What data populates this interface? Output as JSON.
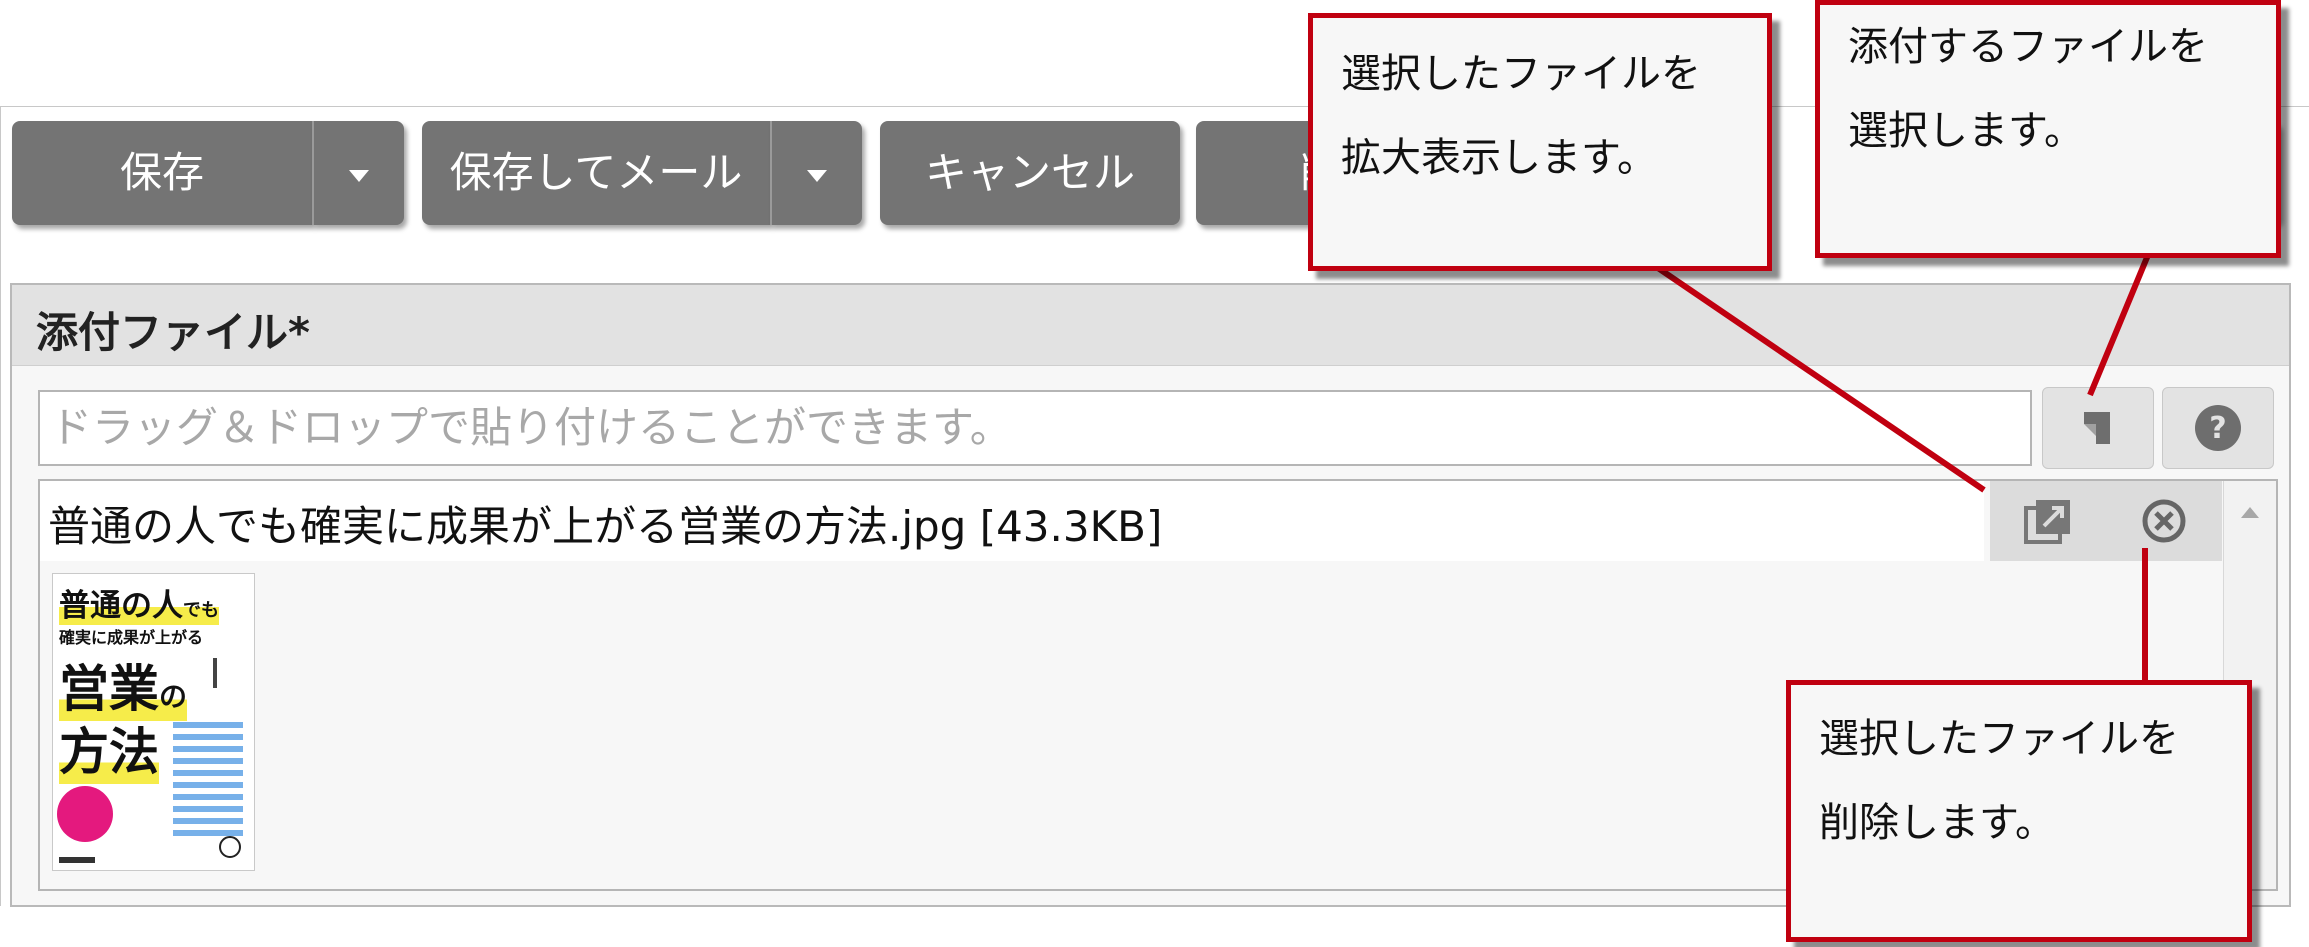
{
  "toolbar": {
    "save_label": "保存",
    "save_mail_label": "保存してメール",
    "cancel_label": "キャンセル",
    "hidden_button_char": "削"
  },
  "section": {
    "title": "添付ファイル*",
    "drop_placeholder": "ドラッグ＆ドロップで貼り付けることができます。"
  },
  "file": {
    "name": "普通の人でも確実に成果が上がる営業の方法.jpg [43.3KB]"
  },
  "thumbnail": {
    "title_line1": "普通の人",
    "title_line1_small": "でも",
    "title_line2": "確実に成果が上がる",
    "title_line3": "営業",
    "title_line3_small": "の",
    "title_line4": "方法"
  },
  "callouts": {
    "enlarge": [
      "選択したファイルを",
      "拡大表示します。"
    ],
    "attach": [
      "添付するファイルを",
      "選択します。"
    ],
    "delete": [
      "選択したファイルを",
      "削除します。"
    ]
  },
  "icons": {
    "attach": "attach-file-icon",
    "help": "help-icon",
    "enlarge": "enlarge-icon",
    "delete": "delete-icon"
  },
  "colors": {
    "button_bg": "#747474",
    "callout_border": "#c00010",
    "section_header_bg": "#e2e2e2"
  }
}
